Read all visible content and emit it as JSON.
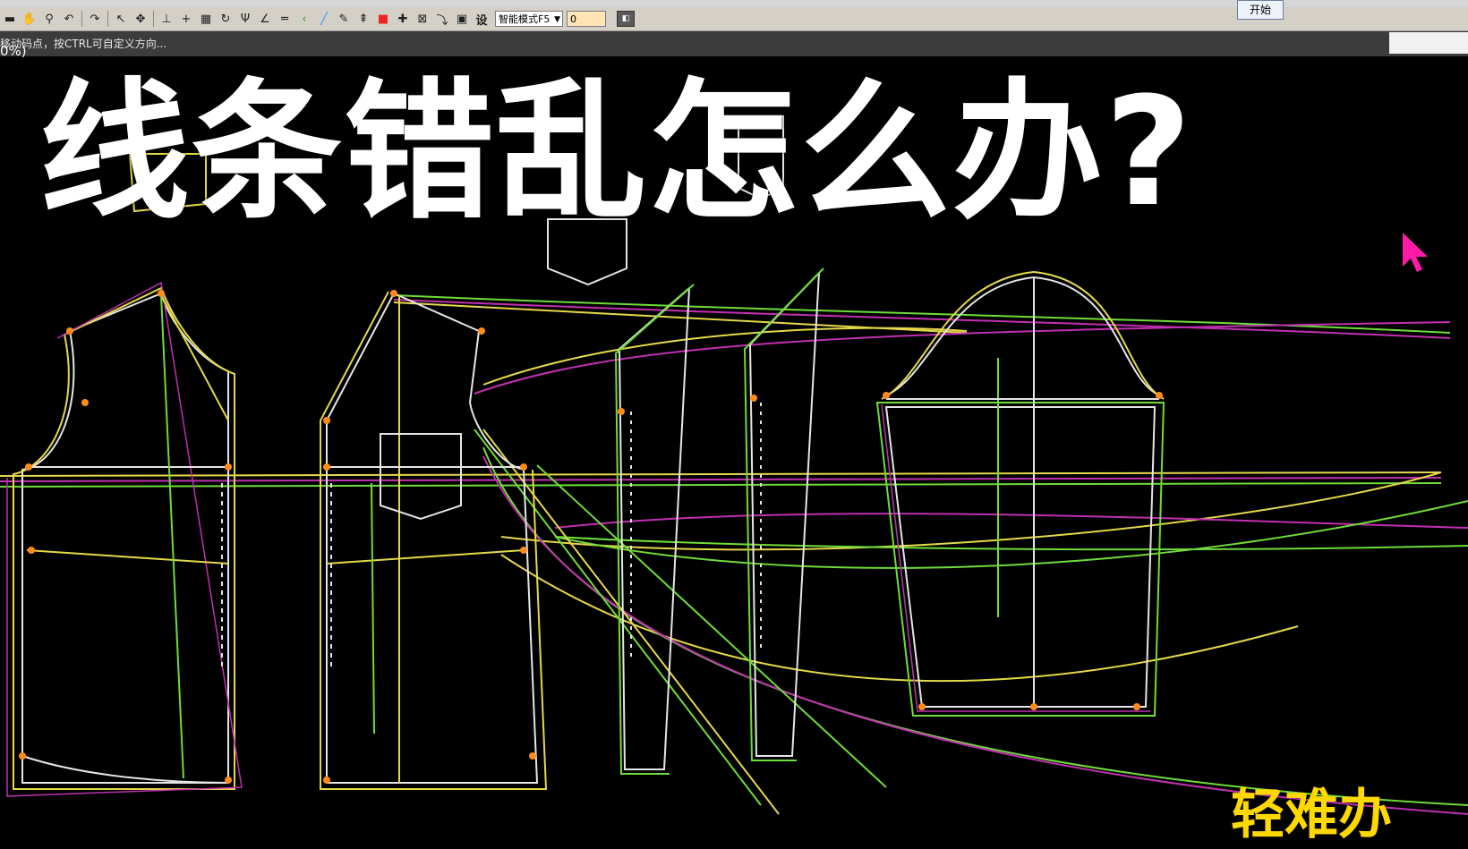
{
  "app": {
    "start_button": "开始"
  },
  "toolbar": {
    "mode_select": "智能模式F5",
    "value_input": "0",
    "setting_label": "设",
    "icons": [
      "open-icon",
      "hand-icon",
      "zoom-icon",
      "undo-icon",
      "redo-icon",
      "select-icon",
      "move-icon",
      "align-icon",
      "cross-icon",
      "rotate-icon",
      "mirror-icon",
      "angle-icon",
      "parallel-icon",
      "curve-icon",
      "measure-icon",
      "tool-icon",
      "color-icon",
      "plus-icon",
      "grid-icon",
      "arrow-icon",
      "frame-icon"
    ]
  },
  "status": {
    "hint": "移动码点，按CTRL可自定义方向...",
    "zoom": "0%)"
  },
  "overlay": {
    "title": "线条错乱怎么办?",
    "subtitle": "轻难办"
  },
  "colors": {
    "background": "#000000",
    "pattern_white": "#e6e6e6",
    "pattern_yellow": "#e5d94a",
    "pattern_green": "#6fdc3a",
    "pattern_magenta": "#c030b0",
    "point_orange": "#ff8c1a",
    "cursor": "#ff1aa8",
    "subtitle": "#ffd800"
  }
}
